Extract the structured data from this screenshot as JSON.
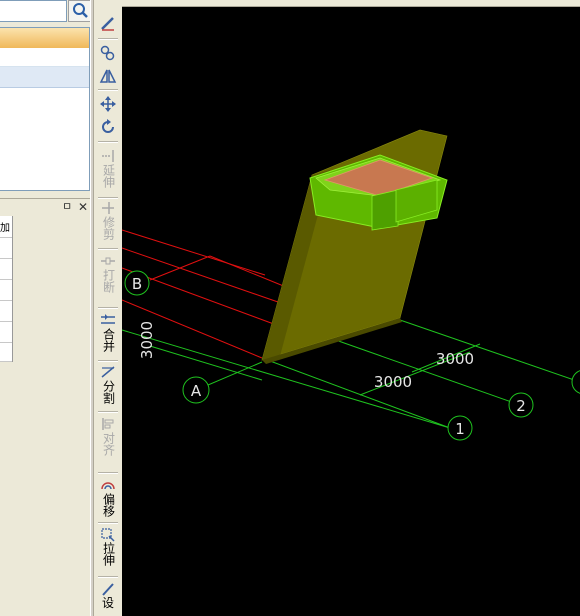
{
  "viewport": {
    "axis_labels": {
      "A": "A",
      "B": "B",
      "one": "1",
      "two": "2"
    },
    "dimensions": {
      "vertical": "3000",
      "bay_1": "3000",
      "bay_2": "3000"
    }
  },
  "toolbar": {
    "extend": "延伸",
    "trim": "修剪",
    "break": "打断",
    "merge": "合并",
    "split": "分割",
    "align": "对齐",
    "offset": "偏移",
    "stretch": "拉伸",
    "settings": "设"
  },
  "panel": {
    "pin": "ㅁ",
    "close": "✕",
    "prop_cell": "加"
  },
  "colors": {
    "grid_green": "#1fc21f",
    "grid_red": "#e01010",
    "wall_olive": "#6b6b00",
    "beam_green": "#66cc00",
    "slab_orange": "#c87850"
  }
}
